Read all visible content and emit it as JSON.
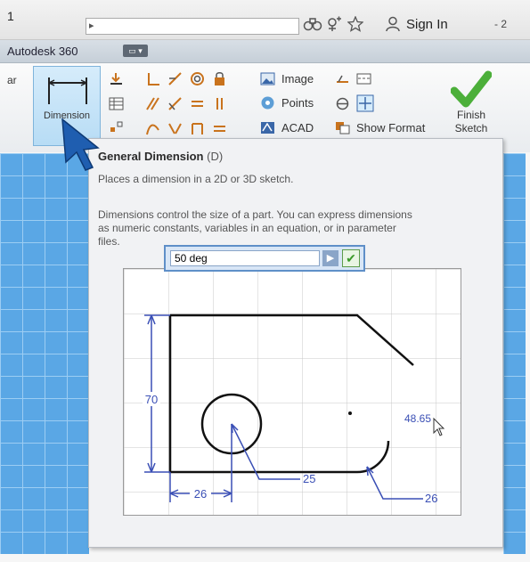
{
  "window": {
    "title_fragment": "1",
    "search_caret": "▸",
    "sign_in": "Sign In",
    "right_fragment": "- 2"
  },
  "app_strip": {
    "app_name": "Autodesk 360",
    "menu_glyph": "▭ ▾"
  },
  "ribbon": {
    "left_fragment": "ar",
    "dimension_label": "Dimension",
    "image_label": "Image",
    "points_label": "Points",
    "acad_label": "ACAD",
    "show_format_label": "Show Format",
    "finish_sketch_label_line1": "Finish",
    "finish_sketch_label_line2": "Sketch",
    "accent_color": "#5aa7e5",
    "finish_color": "#4caf3a"
  },
  "tooltip": {
    "title": "General Dimension",
    "shortcut": "(D)",
    "line1": "Places a dimension in a 2D or 3D sketch.",
    "para2_line1": "Dimensions control the size of a part. You can express dimensions",
    "para2_line2": "as numeric constants, variables in an equation, or in parameter",
    "para2_line3": "files."
  },
  "diagram": {
    "dim_height": "70",
    "dim_width": "26",
    "dim_radius1": "25",
    "dim_radius2": "26",
    "dim_edit": "48.65",
    "input_value": "50 deg",
    "dim_color": "#3a4fb5"
  }
}
